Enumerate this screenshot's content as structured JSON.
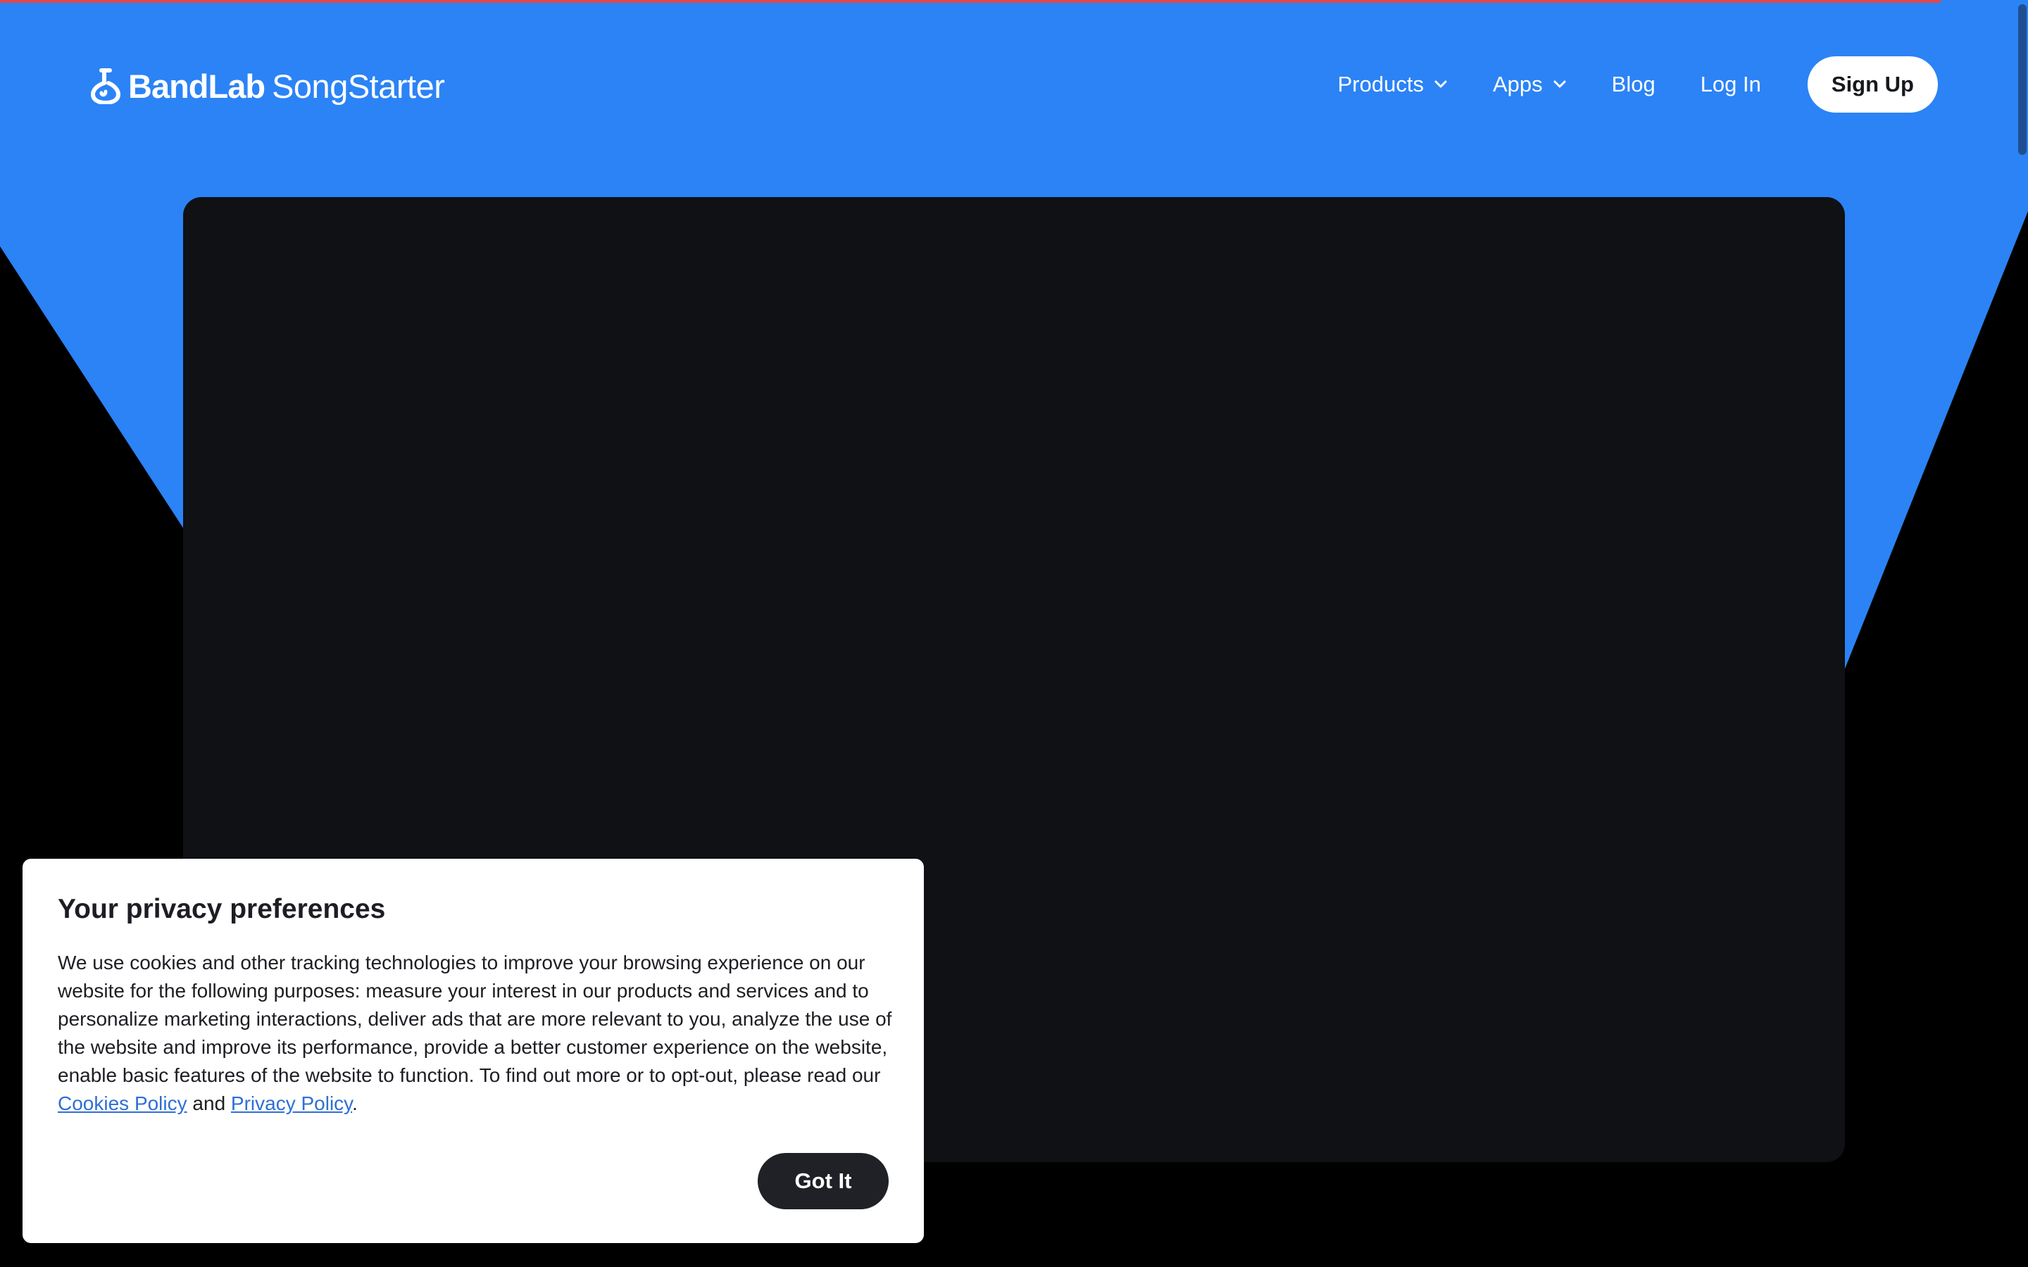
{
  "colors": {
    "brand_blue": "#2b83f6",
    "page_background": "#000000",
    "video_panel": "#0f1114",
    "top_accent": "#e0474c",
    "link": "#2f6fd6",
    "dark_button": "#1f2126"
  },
  "header": {
    "logo_brand": "BandLab",
    "logo_product": "SongStarter",
    "logo_icon": "bandlab-logo-icon",
    "nav": {
      "products_label": "Products",
      "apps_label": "Apps",
      "blog_label": "Blog",
      "login_label": "Log In",
      "signup_label": "Sign Up"
    }
  },
  "cookie_banner": {
    "title": "Your privacy preferences",
    "body_text": "We use cookies and other tracking technologies to improve your browsing experience on our website for the following purposes: measure your interest in our products and services and to personalize marketing interactions, deliver ads that are more relevant to you, analyze the use of the website and improve its performance, provide a better customer experience on the website, enable basic features of the website to function. To find out more or to opt-out, please read our ",
    "cookies_policy_link": "Cookies Policy",
    "and_text": " and ",
    "privacy_policy_link": "Privacy Policy",
    "end_text": ".",
    "got_it_label": "Got It"
  }
}
